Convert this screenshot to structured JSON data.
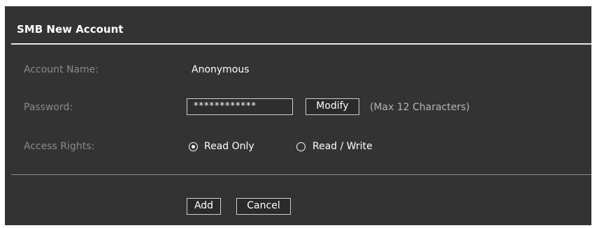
{
  "dialog": {
    "title": "SMB New Account"
  },
  "account_name": {
    "label": "Account Name:",
    "value": "Anonymous"
  },
  "password": {
    "label": "Password:",
    "masked_value": "************",
    "modify_label": "Modify",
    "hint": "(Max 12 Characters)"
  },
  "access_rights": {
    "label": "Access Rights:",
    "options": [
      {
        "label": "Read Only",
        "selected": true
      },
      {
        "label": "Read / Write",
        "selected": false
      }
    ]
  },
  "actions": {
    "add_label": "Add",
    "cancel_label": "Cancel"
  },
  "colors": {
    "panel_background": "#333333",
    "label_text": "#8a8a8a",
    "value_text": "#ffffff",
    "border": "#cfcfcf"
  }
}
